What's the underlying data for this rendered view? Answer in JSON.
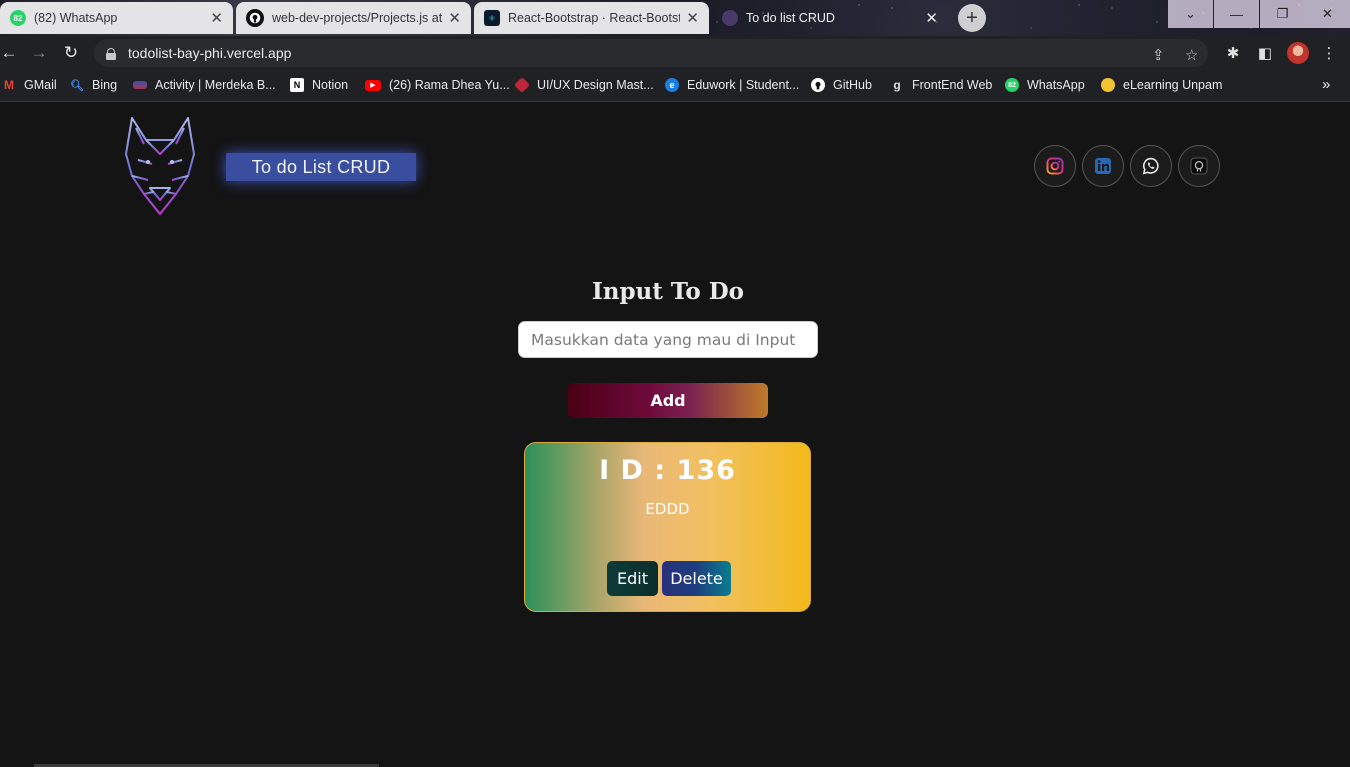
{
  "browser": {
    "tabs": [
      {
        "title": "(82) WhatsApp",
        "badge": "82",
        "active": false
      },
      {
        "title": "web-dev-projects/Projects.js at m",
        "active": false
      },
      {
        "title": "React-Bootstrap · React-Bootstrap",
        "active": false
      },
      {
        "title": "To do list CRUD",
        "active": true
      }
    ],
    "url": "todolist-bay-phi.vercel.app",
    "bookmarks": [
      {
        "label": "GMail"
      },
      {
        "label": "Bing"
      },
      {
        "label": "Activity | Merdeka B..."
      },
      {
        "label": "Notion"
      },
      {
        "label": "(26) Rama Dhea Yu..."
      },
      {
        "label": "UI/UX Design Mast..."
      },
      {
        "label": "Eduwork | Student..."
      },
      {
        "label": "GitHub"
      },
      {
        "label": "FrontEnd Web"
      },
      {
        "label": "WhatsApp",
        "badge": "82"
      },
      {
        "label": "eLearning Unpam"
      }
    ]
  },
  "app": {
    "brand": "To do List CRUD",
    "heading": "Input To Do",
    "input": {
      "placeholder": "Masukkan data yang mau di Input",
      "value": ""
    },
    "add_label": "Add",
    "todo": {
      "id_label": "I D : 136",
      "text": "EDDD",
      "edit_label": "Edit",
      "delete_label": "Delete"
    },
    "social_icons": [
      "instagram-icon",
      "linkedin-icon",
      "whatsapp-icon",
      "github-icon"
    ]
  }
}
